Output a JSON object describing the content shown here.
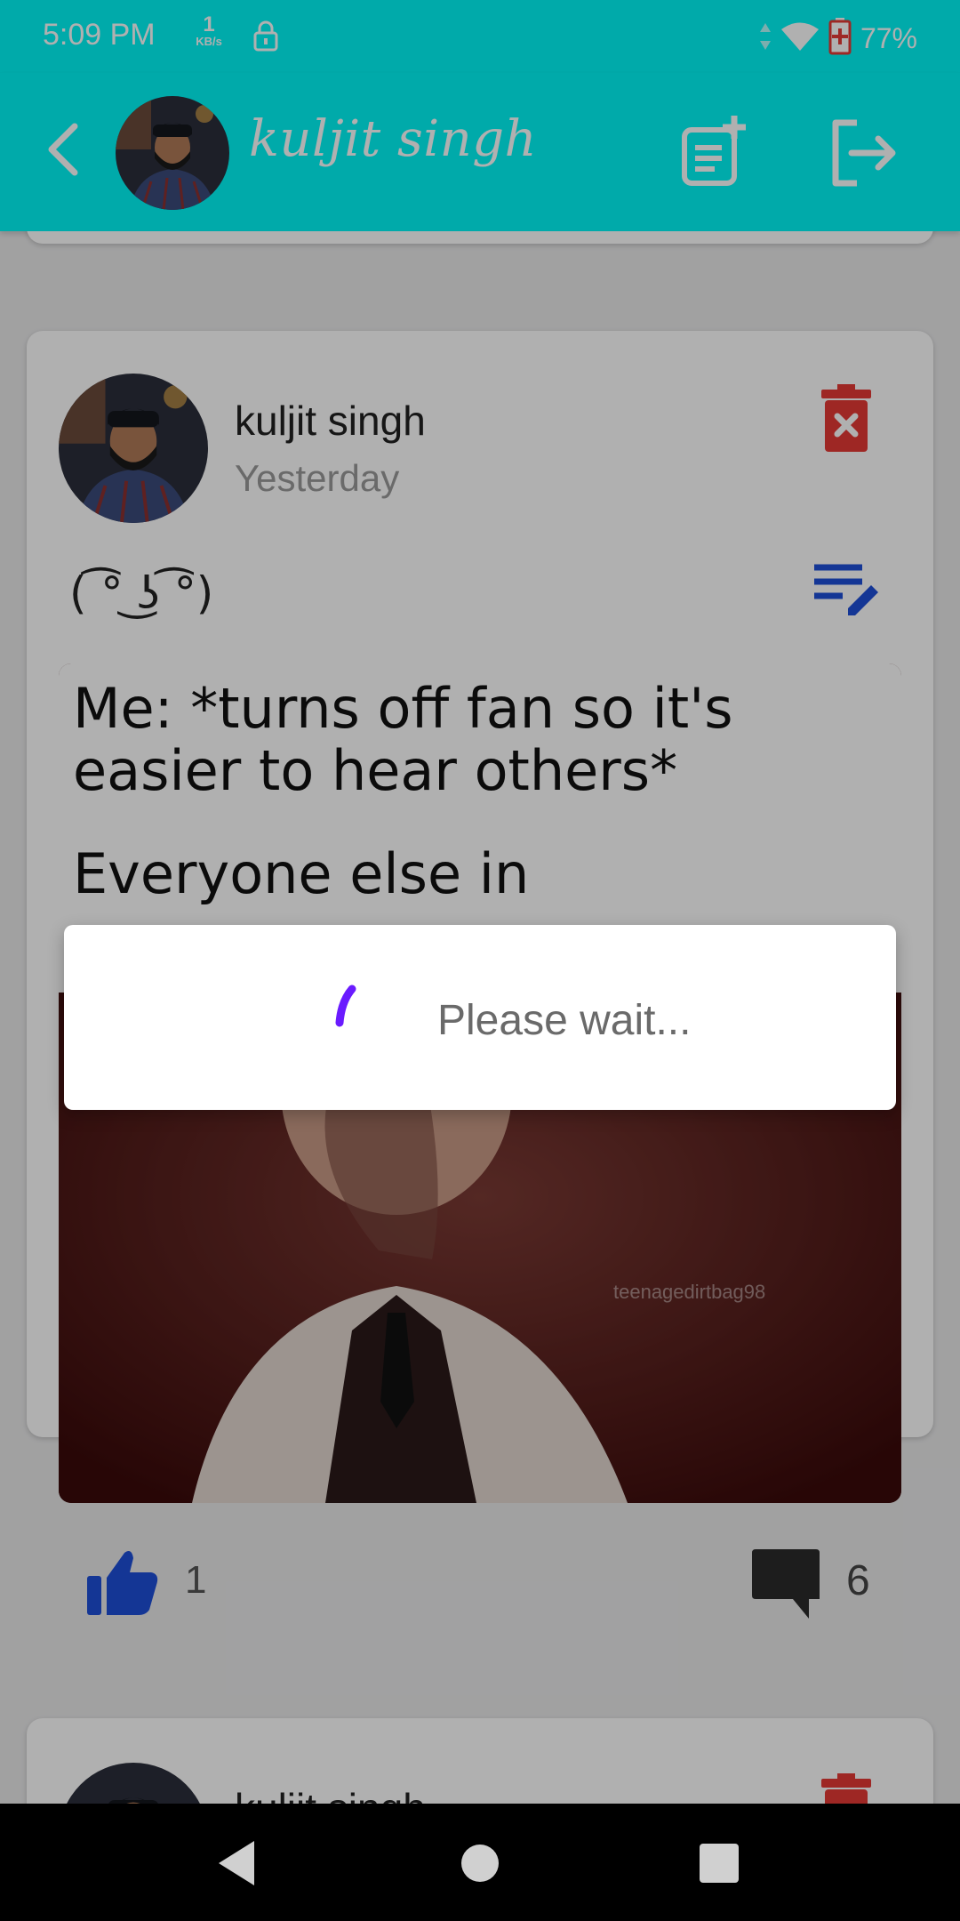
{
  "status_bar": {
    "time": "5:09 PM",
    "net_speed_value": "1",
    "net_speed_unit": "KB/s",
    "battery": "77%"
  },
  "header": {
    "profile_name": "kuljit singh",
    "icons": [
      "back-arrow-icon",
      "new-post-icon",
      "logout-icon"
    ]
  },
  "post": {
    "author": "kuljit singh",
    "time": "Yesterday",
    "text": "( ͡° ͜ʖ ͡°)",
    "image_caption_line1": "Me: *turns off fan so it's",
    "image_caption_line2": "easier to hear others*",
    "image_caption_line3": "Everyone else in",
    "image_watermark": "teenagedirtbag98",
    "likes": "1",
    "comments": "6"
  },
  "next_post": {
    "author": "kuljit singh"
  },
  "dialog": {
    "message": "Please wait..."
  },
  "colors": {
    "app_bar": "#00f7f7",
    "delete": "#e53935",
    "accent_blue": "#1e4fd8",
    "spinner": "#6a1bff"
  }
}
